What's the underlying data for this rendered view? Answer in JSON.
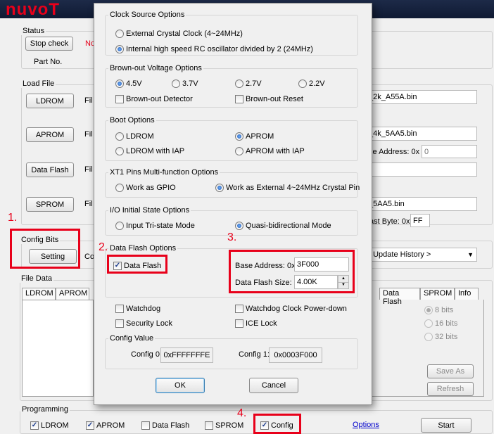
{
  "app": {
    "logo_text": "nuvoT",
    "status_group": "Status",
    "stop_check": "Stop check",
    "status_text_partial": "No",
    "part_no_label": "Part No.",
    "load_file_group": "Load File",
    "ldrom_button": "LDROM",
    "aprom_button": "APROM",
    "dataflash_button": "Data Flash",
    "sprom_button": "SPROM",
    "file_label": "Fil",
    "ldrom_file": "_2k_A55A.bin",
    "aprom_file": "_4k_5AA5.bin",
    "base_address_label": "se Address: 0x",
    "base_address_value": "0",
    "sprom_file": "_5AA5.bin",
    "last_byte_label": "ast Byte: 0x",
    "last_byte_value": "FF",
    "config_bits_group": "Config Bits",
    "setting_button": "Setting",
    "config_partial": "Co",
    "history_dropdown": ": Update History >",
    "file_data_group": "File Data",
    "tabs_left": [
      "LDROM",
      "APROM"
    ],
    "tabs_right": [
      "Data Flash",
      "SPROM",
      "Info"
    ],
    "bits_options": [
      "8 bits",
      "16 bits",
      "32 bits"
    ],
    "save_as": "Save As",
    "refresh": "Refresh",
    "programming_group": "Programming",
    "prog_ldrom": "LDROM",
    "prog_aprom": "APROM",
    "prog_dataflash": "Data Flash",
    "prog_sprom": "SPROM",
    "prog_config": "Config",
    "options_link": "Options",
    "start_button": "Start"
  },
  "annotations": [
    "1.",
    "2.",
    "3.",
    "4."
  ],
  "dialog": {
    "clock": {
      "title": "Clock Source Options",
      "opt1": "External Crystal Clock (4~24MHz)",
      "opt2": "Internal high speed RC oscillator divided by 2 (24MHz)"
    },
    "brownout": {
      "title": "Brown-out Voltage Options",
      "v1": "4.5V",
      "v2": "3.7V",
      "v3": "2.7V",
      "v4": "2.2V",
      "detector": "Brown-out Detector",
      "reset": "Brown-out Reset"
    },
    "boot": {
      "title": "Boot Options",
      "ldrom": "LDROM",
      "aprom": "APROM",
      "ldrom_iap": "LDROM with IAP",
      "aprom_iap": "APROM with IAP"
    },
    "xt1": {
      "title": "XT1 Pins Multi-function Options",
      "gpio": "Work as GPIO",
      "crystal": "Work as External 4~24MHz Crystal Pin"
    },
    "io": {
      "title": "I/O Initial State Options",
      "tristate": "Input Tri-state Mode",
      "quasi": "Quasi-bidirectional Mode"
    },
    "dataflash": {
      "title": "Data Flash Options",
      "checkbox": "Data Flash",
      "base_label": "Base Address: 0x",
      "base_value": "3F000",
      "size_label": "Data Flash Size:",
      "size_value": "4.00K"
    },
    "misc": {
      "watchdog": "Watchdog",
      "watchdog_pd": "Watchdog Clock Power-down",
      "security": "Security Lock",
      "ice": "ICE Lock"
    },
    "config_value": {
      "title": "Config Value",
      "c0_label": "Config 0:",
      "c0_value": "0xFFFFFFFE",
      "c1_label": "Config 1:",
      "c1_value": "0x0003F000"
    },
    "ok": "OK",
    "cancel": "Cancel"
  }
}
